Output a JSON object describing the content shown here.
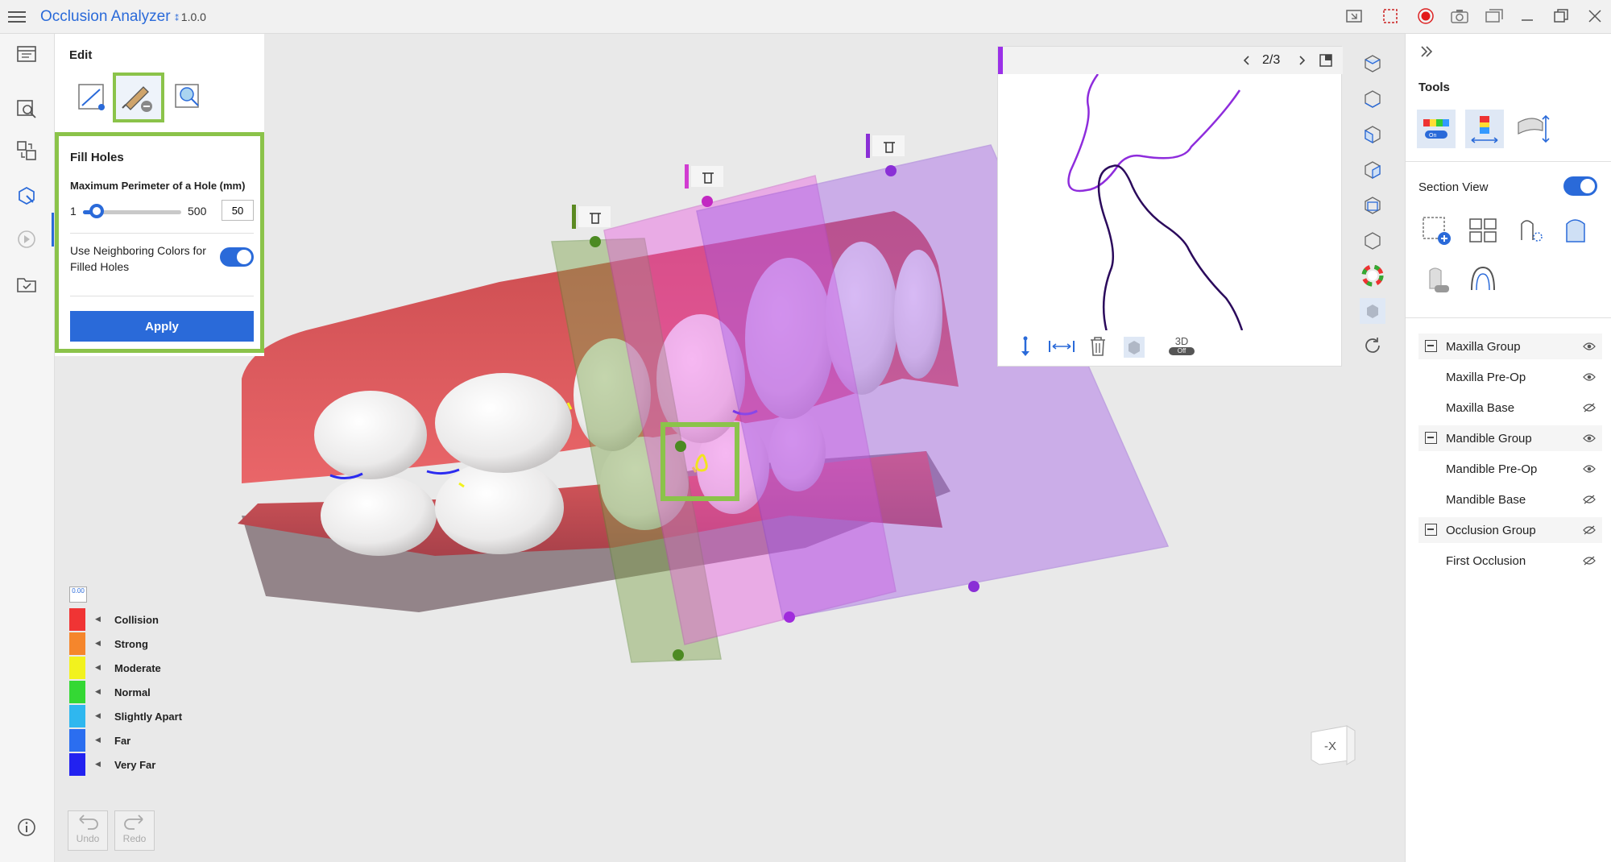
{
  "app": {
    "title": "Occlusion Analyzer",
    "version": "1.0.0"
  },
  "edit_panel": {
    "title": "Edit",
    "fill_holes": {
      "title": "Fill Holes",
      "perimeter_label": "Maximum Perimeter of a Hole (mm)",
      "slider_min": "1",
      "slider_max": "500",
      "value": "50",
      "neighbor_label": "Use Neighboring Colors for Filled Holes",
      "apply_label": "Apply"
    }
  },
  "legend": {
    "reset_label": "0.00",
    "items": [
      {
        "label": "Collision",
        "color": "#f03434"
      },
      {
        "label": "Strong",
        "color": "#f5862c"
      },
      {
        "label": "Moderate",
        "color": "#f2f21e"
      },
      {
        "label": "Normal",
        "color": "#34d834"
      },
      {
        "label": "Slightly Apart",
        "color": "#2fb7ef"
      },
      {
        "label": "Far",
        "color": "#2b6ef0"
      },
      {
        "label": "Very Far",
        "color": "#2222f0"
      }
    ]
  },
  "history": {
    "undo": "Undo",
    "redo": "Redo"
  },
  "section_popup": {
    "page": "2/3",
    "mode_3d": "3D",
    "mode_3d_state": "Off"
  },
  "viewport": {
    "nav_cube_label": "-X"
  },
  "right_panel": {
    "tools_title": "Tools",
    "section_view_label": "Section View",
    "tree": [
      {
        "label": "Maxilla Group",
        "group": true,
        "visible": true
      },
      {
        "label": "Maxilla Pre-Op",
        "group": false,
        "visible": true
      },
      {
        "label": "Maxilla Base",
        "group": false,
        "visible": false
      },
      {
        "label": "Mandible Group",
        "group": true,
        "visible": true
      },
      {
        "label": "Mandible Pre-Op",
        "group": false,
        "visible": true
      },
      {
        "label": "Mandible Base",
        "group": false,
        "visible": false
      },
      {
        "label": "Occlusion Group",
        "group": true,
        "visible": false
      },
      {
        "label": "First Occlusion",
        "group": false,
        "visible": false
      }
    ]
  },
  "colors": {
    "accent": "#2a6ad9",
    "highlight": "#8bc34a"
  }
}
